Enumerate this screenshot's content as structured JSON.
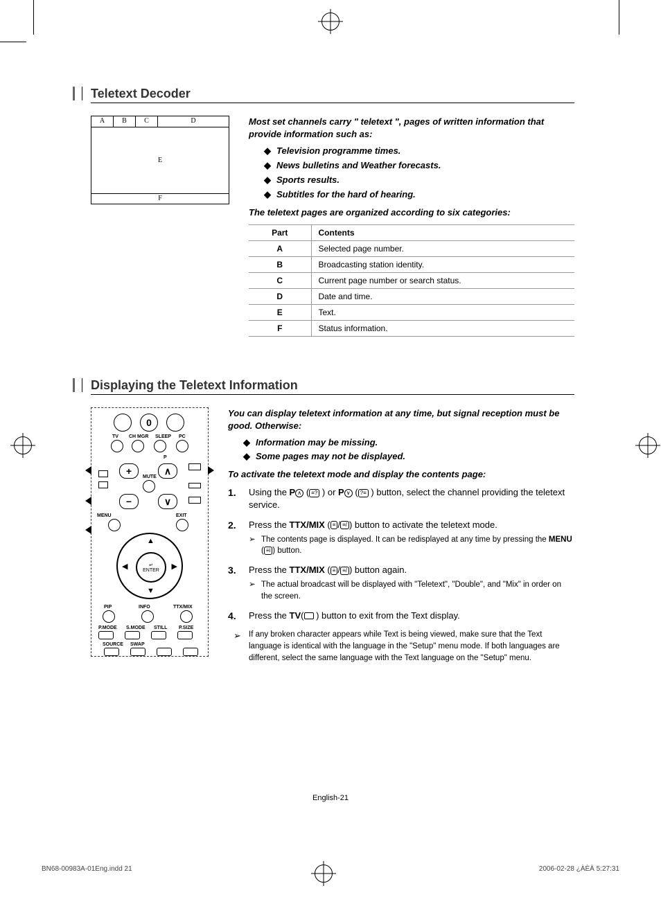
{
  "sections": {
    "teletext_decoder": {
      "title": "Teletext Decoder",
      "intro": "Most set channels carry \" teletext \", pages of written information that provide information such as:",
      "bullets": [
        "Television programme times.",
        "News bulletins and Weather forecasts.",
        "Sports results.",
        "Subtitles for the hard of hearing."
      ],
      "categories_line": "The teletext pages are organized according to six categories:",
      "table": {
        "headers": [
          "Part",
          "Contents"
        ],
        "rows": [
          [
            "A",
            "Selected page number."
          ],
          [
            "B",
            "Broadcasting station identity."
          ],
          [
            "C",
            "Current page number or search status."
          ],
          [
            "D",
            "Date and time."
          ],
          [
            "E",
            "Text."
          ],
          [
            "F",
            "Status information."
          ]
        ]
      },
      "diagram_cells": {
        "a": "A",
        "b": "B",
        "c": "C",
        "d": "D",
        "e": "E",
        "f": "F"
      }
    },
    "displaying": {
      "title": "Displaying the Teletext Information",
      "intro": "You can display teletext information at any time, but signal reception must be good. Otherwise:",
      "bullets": [
        "Information may be missing.",
        "Some pages may not be displayed."
      ],
      "activate": "To activate the teletext mode and display the contents page:",
      "steps": [
        {
          "text_parts": [
            "Using the ",
            "P",
            " (",
            " ) or ",
            "P",
            " (",
            " ) button, select the channel providing the teletext service."
          ]
        },
        {
          "text_parts": [
            "Press the ",
            "TTX/MIX",
            " (",
            "/",
            ") button to activate the teletext mode."
          ],
          "sub_parts": [
            "The contents page is displayed. It can be redisplayed at any time by pressing the ",
            "MENU",
            " (",
            ") button."
          ]
        },
        {
          "text_parts": [
            "Press the ",
            "TTX/MIX",
            " (",
            "/",
            ") button again."
          ],
          "sub": "The actual broadcast will be displayed with \"Teletext\", \"Double\", and \"Mix\" in order on the screen."
        },
        {
          "text_parts": [
            "Press the ",
            "TV",
            "(",
            " ) button to exit from the Text display."
          ]
        }
      ],
      "note": "If any broken character appears while Text is being viewed, make sure that the Text language is identical with the language in the \"Setup\" menu mode. If both languages are different, select the same language with the Text language on the \"Setup\" menu."
    },
    "remote_labels": {
      "tv": "TV",
      "chmgr": "CH MGR",
      "sleep": "SLEEP",
      "pc": "PC",
      "p": "P",
      "mute": "MUTE",
      "menu": "MENU",
      "exit": "EXIT",
      "enter": "ENTER",
      "pip": "PIP",
      "info": "INFO",
      "ttxmix": "TTX/MIX",
      "pmode": "P.MODE",
      "smode": "S.MODE",
      "still": "STILL",
      "psize": "P.SIZE",
      "source": "SOURCE",
      "swap": "SWAP",
      "zero": "0",
      "plus": "+",
      "minus": "−",
      "up": "∧",
      "down": "∨",
      "enter_icon": "↵"
    }
  },
  "footer": {
    "page": "English-21",
    "file": "BN68-00983A-01Eng.indd   21",
    "timestamp": "2006-02-28   ¿ÀÈÄ 5:27:31"
  }
}
